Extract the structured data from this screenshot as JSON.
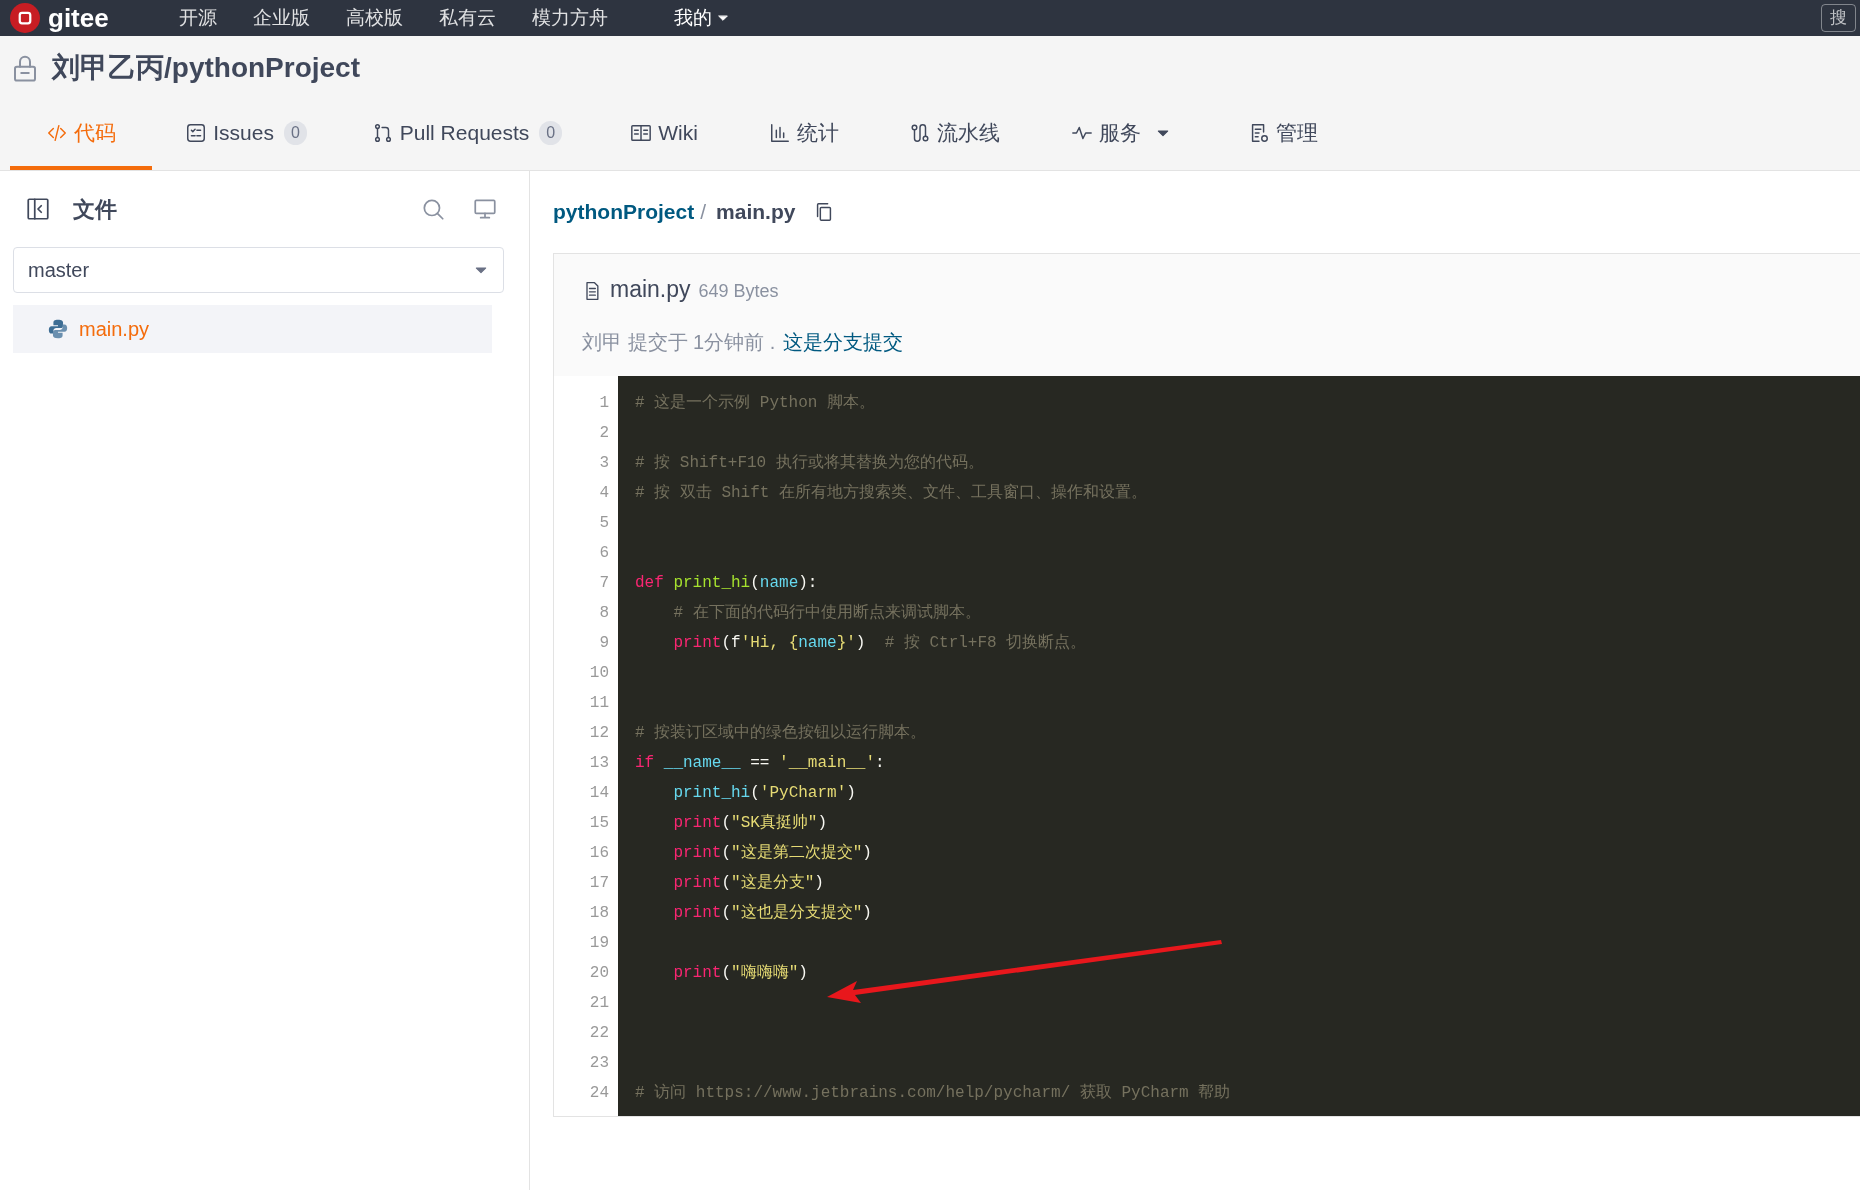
{
  "top_nav": {
    "logo": "gitee",
    "items": [
      "开源",
      "企业版",
      "高校版",
      "私有云",
      "模力方舟"
    ],
    "user_menu": "我的",
    "search_button": "搜"
  },
  "repo": {
    "title": "刘甲乙丙/pythonProject",
    "private": true
  },
  "tabs": [
    {
      "label": "代码",
      "selected": true
    },
    {
      "label": "Issues",
      "count": "0",
      "selected": false
    },
    {
      "label": "Pull Requests",
      "count": "0",
      "selected": false
    },
    {
      "label": "Wiki",
      "selected": false
    },
    {
      "label": "统计",
      "selected": false
    },
    {
      "label": "流水线",
      "selected": false
    },
    {
      "label": "服务",
      "dropdown": true,
      "selected": false
    },
    {
      "label": "管理",
      "selected": false
    }
  ],
  "sidebar": {
    "title": "文件",
    "branch": "master",
    "files": [
      {
        "name": "main.py",
        "selected": true
      }
    ]
  },
  "breadcrumb": {
    "repo": "pythonProject",
    "separator": "/",
    "file": "main.py"
  },
  "file": {
    "name": "main.py",
    "size": "649 Bytes",
    "commit_info": "刘甲 提交于 1分钟前 .",
    "commit_message": "这是分支提交"
  },
  "code": [
    {
      "number": "1",
      "tokens": [
        {
          "kind": "comment",
          "text": "# 这是一个示例 Python 脚本。"
        }
      ]
    },
    {
      "number": "2"
    },
    {
      "number": "3",
      "tokens": [
        {
          "kind": "comment",
          "text": "# 按 Shift+F10 执行或将其替换为您的代码。"
        }
      ]
    },
    {
      "number": "4",
      "tokens": [
        {
          "kind": "comment",
          "text": "# 按 双击 Shift 在所有地方搜索类、文件、工具窗口、操作和设置。"
        }
      ]
    },
    {
      "number": "5"
    },
    {
      "number": "6"
    },
    {
      "number": "7",
      "tokens": [
        {
          "kind": "keyword",
          "text": "def "
        },
        {
          "kind": "function",
          "text": "print_hi"
        },
        {
          "kind": "plain",
          "text": "("
        },
        {
          "kind": "name",
          "text": "name"
        },
        {
          "kind": "plain",
          "text": "):"
        }
      ]
    },
    {
      "number": "8",
      "indented": true,
      "tokens": [
        {
          "kind": "comment",
          "text": "# 在下面的代码行中使用断点来调试脚本。"
        }
      ]
    },
    {
      "number": "9",
      "indented": true,
      "tokens": [
        {
          "kind": "keyword",
          "text": "print"
        },
        {
          "kind": "plain",
          "text": "(f"
        },
        {
          "kind": "string",
          "text": "'Hi, {"
        },
        {
          "kind": "name",
          "text": "name"
        },
        {
          "kind": "string",
          "text": "}'"
        },
        {
          "kind": "plain",
          "text": ")  "
        },
        {
          "kind": "comment",
          "text": "# 按 Ctrl+F8 切换断点。"
        }
      ]
    },
    {
      "number": "10"
    },
    {
      "number": "11"
    },
    {
      "number": "12",
      "tokens": [
        {
          "kind": "comment",
          "text": "# 按装订区域中的绿色按钮以运行脚本。"
        }
      ]
    },
    {
      "number": "13",
      "tokens": [
        {
          "kind": "keyword",
          "text": "if "
        },
        {
          "kind": "name",
          "text": "__name__"
        },
        {
          "kind": "plain",
          "text": " == "
        },
        {
          "kind": "string",
          "text": "'__main__'"
        },
        {
          "kind": "plain",
          "text": ":"
        }
      ]
    },
    {
      "number": "14",
      "indented": true,
      "tokens": [
        {
          "kind": "name",
          "text": "print_hi"
        },
        {
          "kind": "plain",
          "text": "("
        },
        {
          "kind": "string",
          "text": "'PyCharm'"
        },
        {
          "kind": "plain",
          "text": ")"
        }
      ]
    },
    {
      "number": "15",
      "indented": true,
      "tokens": [
        {
          "kind": "keyword",
          "text": "print"
        },
        {
          "kind": "plain",
          "text": "("
        },
        {
          "kind": "string",
          "text": "\"SK真挺帅\""
        },
        {
          "kind": "plain",
          "text": ")"
        }
      ]
    },
    {
      "number": "16",
      "indented": true,
      "tokens": [
        {
          "kind": "keyword",
          "text": "print"
        },
        {
          "kind": "plain",
          "text": "("
        },
        {
          "kind": "string",
          "text": "\"这是第二次提交\""
        },
        {
          "kind": "plain",
          "text": ")"
        }
      ]
    },
    {
      "number": "17",
      "indented": true,
      "tokens": [
        {
          "kind": "keyword",
          "text": "print"
        },
        {
          "kind": "plain",
          "text": "("
        },
        {
          "kind": "string",
          "text": "\"这是分支\""
        },
        {
          "kind": "plain",
          "text": ")"
        }
      ]
    },
    {
      "number": "18",
      "indented": true,
      "tokens": [
        {
          "kind": "keyword",
          "text": "print"
        },
        {
          "kind": "plain",
          "text": "("
        },
        {
          "kind": "string",
          "text": "\"这也是分支提交\""
        },
        {
          "kind": "plain",
          "text": ")"
        }
      ]
    },
    {
      "number": "19"
    },
    {
      "number": "20",
      "indented": true,
      "tokens": [
        {
          "kind": "keyword",
          "text": "print"
        },
        {
          "kind": "plain",
          "text": "("
        },
        {
          "kind": "string",
          "text": "\"嗨嗨嗨\""
        },
        {
          "kind": "plain",
          "text": ")"
        }
      ]
    },
    {
      "number": "21"
    },
    {
      "number": "22"
    },
    {
      "number": "23"
    },
    {
      "number": "24",
      "tokens": [
        {
          "kind": "comment",
          "text": "# 访问 https://www.jetbrains.com/help/pycharm/ 获取 PyCharm 帮助"
        }
      ]
    }
  ]
}
